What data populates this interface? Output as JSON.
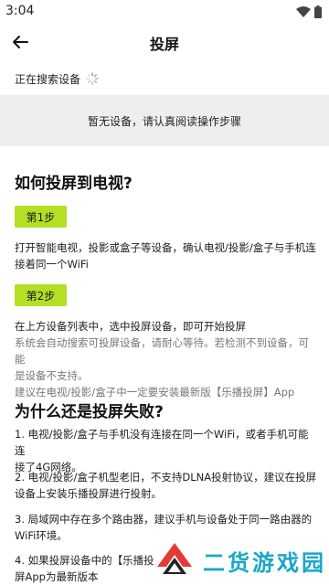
{
  "status": {
    "time": "3:04"
  },
  "header": {
    "title": "投屏"
  },
  "search": {
    "label": "正在搜索设备"
  },
  "empty": {
    "message": "暂无设备，请认真阅读操作步骤"
  },
  "howto": {
    "title": "如何投屏到电视?",
    "step1_label": "第1步",
    "step1_text_l1": "打开智能电视，投影或盒子等设备，确认电视/投影/盒子与手机连",
    "step1_text_l2": "接着同一个WiFi",
    "step2_label": "第2步",
    "step2_text": "在上方设备列表中，选中投屏设备，即可开始投屏",
    "step2_note_l1": "系统会自动搜索可投屏设备，请耐心等待。若检测不到设备，可能",
    "step2_note_l2": "是设备不支持。",
    "step2_note_l3": "建议在电视/投影/盒子中一定要安装最新版【乐播投屏】App"
  },
  "failure": {
    "title": "为什么还是投屏失败?",
    "item1_l1": "1. 电视/投影/盒子与手机没有连接在同一个WiFi，或者手机可能连",
    "item1_l2": "接了4G网络。",
    "item2_l1": " 2. 电视/投影/盒子机型老旧，不支持DLNA投射协议，建议在投屏",
    "item2_l2": "设备上安装乐播投屏进行投射。",
    "item3_l1": " 3. 局域网中存在多个路由器，建议手机与设备处于同一路由器的",
    "item3_l2": "WiFi环境。",
    "item4_l1": " 4. 如果投屏设备中的【乐播投",
    "item4_l2": "屏App为最新版本"
  },
  "watermark": {
    "text": "二货游戏园"
  },
  "colors": {
    "accent": "#b3e024",
    "empty_bg": "#eeeeee",
    "watermark_blue": "#19a7c9"
  }
}
